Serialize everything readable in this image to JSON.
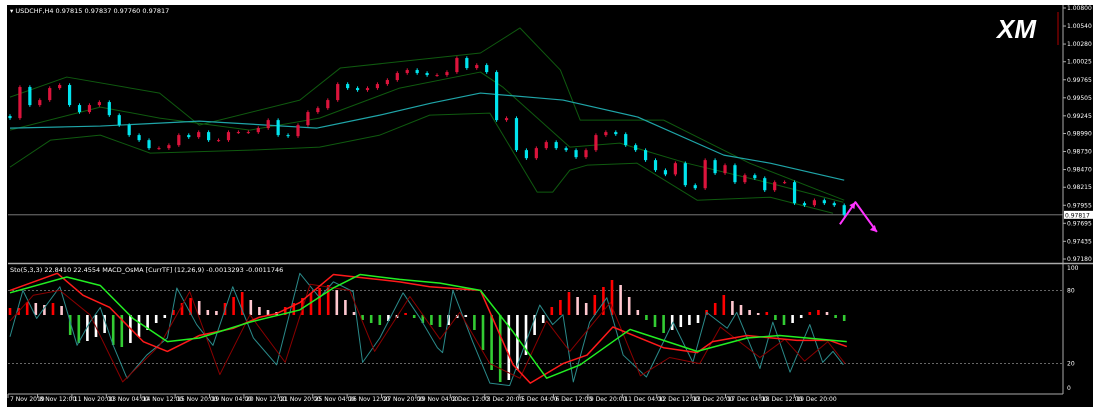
{
  "window": {
    "symbol_header": "USDCHF,H4  0.97815 0.97837 0.97760 0.97817",
    "subwindow_header": "Sto(5,3,3) 22.8410 22.4554  MACD_OsMA [CurrTF] (12,26,9) -0.0013293 -0.0011746",
    "logo_text": "XM",
    "current_price_label": "0.97817"
  },
  "colors": {
    "background": "#000000",
    "bull_candle": "#dc143c",
    "bear_candle": "#00e5ee",
    "moving_average": "#1fa5a8",
    "bollinger": "#0f5a0f",
    "stoch_main": "#2a8a8a",
    "stoch_signal": "#8b0000",
    "osc_red": "#ff1a1a",
    "osc_green": "#22ee22",
    "hist_up_rising": "#ff0000",
    "hist_up_falling": "#ffc8d0",
    "hist_down_falling": "#33cc33",
    "hist_down_rising": "#ffffff",
    "arrow": "#ff33ff"
  },
  "chart_data": [
    {
      "type": "candlestick",
      "symbol": "USDCHF",
      "timeframe": "H4",
      "price_ticks": [
        "1.00800",
        "1.00540",
        "1.00280",
        "1.00025",
        "0.99765",
        "0.99505",
        "0.99245",
        "0.98990",
        "0.98730",
        "0.98470",
        "0.98215",
        "0.97955",
        "0.97695",
        "0.97435",
        "0.97180"
      ],
      "ylim": [
        0.9718,
        1.008
      ],
      "time_labels": [
        "7 Nov 2019",
        "8 Nov 12:00",
        "11 Nov 20:00",
        "13 Nov 04:00",
        "14 Nov 12:00",
        "15 Nov 20:00",
        "19 Nov 04:00",
        "20 Nov 12:00",
        "21 Nov 20:00",
        "25 Nov 04:00",
        "26 Nov 12:00",
        "27 Nov 20:00",
        "29 Nov 04:00",
        "2 Dec 12:00",
        "3 Dec 20:00",
        "5 Dec 04:00",
        "6 Dec 12:00",
        "9 Dec 20:00",
        "11 Dec 04:00",
        "12 Dec 12:00",
        "13 Dec 20:00",
        "17 Dec 04:00",
        "18 Dec 12:00",
        "19 Dec 20:00"
      ],
      "xlim": [
        0,
        97
      ],
      "closes": [
        0.99212,
        0.9966,
        0.994,
        0.99472,
        0.99645,
        0.99689,
        0.994,
        0.99299,
        0.994,
        0.99443,
        0.99255,
        0.99111,
        0.98967,
        0.98894,
        0.98779,
        0.98779,
        0.98822,
        0.98967,
        0.98938,
        0.9901,
        0.98894,
        0.98894,
        0.9901,
        0.9901,
        0.9901,
        0.99068,
        0.99183,
        0.98967,
        0.98952,
        0.99111,
        0.99299,
        0.99356,
        0.99472,
        0.99703,
        0.99645,
        0.99616,
        0.99645,
        0.99703,
        0.99761,
        0.99862,
        0.99905,
        0.99862,
        0.99833,
        0.99833,
        0.99876,
        1.00078,
        0.99934,
        0.99977,
        0.99876,
        0.99183,
        0.99212,
        0.9875,
        0.98634,
        0.98779,
        0.98866,
        0.98779,
        0.9875,
        0.98649,
        0.9875,
        0.98967,
        0.9901,
        0.98981,
        0.98822,
        0.9875,
        0.98606,
        0.98461,
        0.984,
        0.98562,
        0.98245,
        0.98201,
        0.98606,
        0.98418,
        0.98533,
        0.98288,
        0.98389,
        0.98346,
        0.98172,
        0.98288,
        0.98288,
        0.97985,
        0.97956,
        0.98028,
        0.97985,
        0.97956,
        0.97817
      ],
      "moving_average": [
        [
          0,
          0.99068
        ],
        [
          10.5,
          0.99097
        ],
        [
          22,
          0.99169
        ],
        [
          35.7,
          0.99068
        ],
        [
          43,
          0.99255
        ],
        [
          49,
          0.99429
        ],
        [
          54.7,
          0.99573
        ],
        [
          61.6,
          0.99501
        ],
        [
          64.3,
          0.99472
        ],
        [
          73,
          0.99227
        ],
        [
          83,
          0.98678
        ],
        [
          88.4,
          0.98562
        ],
        [
          97,
          0.98317
        ]
      ],
      "bollinger_upper": [
        [
          0,
          0.99515
        ],
        [
          6.6,
          0.99804
        ],
        [
          17.4,
          0.99573
        ],
        [
          22,
          0.99111
        ],
        [
          33.7,
          0.99472
        ],
        [
          38.4,
          0.99934
        ],
        [
          54.7,
          1.00151
        ],
        [
          59.3,
          1.00512
        ],
        [
          64,
          0.99905
        ],
        [
          66.3,
          0.99183
        ],
        [
          76,
          0.99183
        ],
        [
          86,
          0.98562
        ],
        [
          97,
          0.98028
        ]
      ],
      "bollinger_middle": [
        [
          0,
          0.99039
        ],
        [
          10.5,
          0.99371
        ],
        [
          17.4,
          0.99212
        ],
        [
          27.9,
          0.99039
        ],
        [
          36,
          0.99212
        ],
        [
          45.3,
          0.99645
        ],
        [
          54.7,
          0.99876
        ],
        [
          57.3,
          0.9966
        ],
        [
          65.1,
          0.98793
        ],
        [
          70.9,
          0.98851
        ],
        [
          78.7,
          0.98562
        ],
        [
          88.4,
          0.98273
        ],
        [
          96.9,
          0.97999
        ]
      ],
      "bollinger_lower": [
        [
          0,
          0.98505
        ],
        [
          4.7,
          0.98894
        ],
        [
          10.5,
          0.98967
        ],
        [
          16.3,
          0.98707
        ],
        [
          27.9,
          0.9875
        ],
        [
          36,
          0.98793
        ],
        [
          43,
          0.98967
        ],
        [
          48.8,
          0.99255
        ],
        [
          55.8,
          0.99284
        ],
        [
          61.3,
          0.98144
        ],
        [
          63.1,
          0.98144
        ],
        [
          65.1,
          0.98461
        ],
        [
          67.1,
          0.98533
        ],
        [
          72.9,
          0.98562
        ],
        [
          79.9,
          0.98028
        ],
        [
          88.4,
          0.98071
        ],
        [
          95.7,
          0.9784
        ]
      ],
      "current_price": 0.97817,
      "annotation_arrow": [
        [
          96.5,
          0.9768
        ],
        [
          98.3,
          0.98
        ],
        [
          100.8,
          0.9757
        ]
      ]
    },
    {
      "type": "line+bar",
      "ylim": [
        0,
        100
      ],
      "y_ticks": [
        "100",
        "80",
        "20",
        "0"
      ],
      "levels": [
        80,
        20
      ],
      "stoch_main": [
        [
          0,
          42
        ],
        [
          1.5,
          80
        ],
        [
          3.1,
          57
        ],
        [
          5.8,
          83
        ],
        [
          7.8,
          35
        ],
        [
          9.3,
          54
        ],
        [
          10.5,
          66
        ],
        [
          12,
          35
        ],
        [
          13.6,
          8
        ],
        [
          15.9,
          27
        ],
        [
          18.3,
          41
        ],
        [
          19.4,
          82
        ],
        [
          21.7,
          52
        ],
        [
          23.6,
          35
        ],
        [
          25.9,
          83
        ],
        [
          28.3,
          41
        ],
        [
          31,
          19
        ],
        [
          33.7,
          94
        ],
        [
          36,
          74
        ],
        [
          37.6,
          87
        ],
        [
          39.9,
          79
        ],
        [
          41,
          21
        ],
        [
          43,
          41
        ],
        [
          45.7,
          78
        ],
        [
          47.7,
          57
        ],
        [
          49.7,
          33
        ],
        [
          50.3,
          29
        ],
        [
          51.5,
          80
        ],
        [
          53.8,
          38
        ],
        [
          55.8,
          4
        ],
        [
          58.1,
          2
        ],
        [
          61.6,
          68
        ],
        [
          63.1,
          52
        ],
        [
          64.3,
          60
        ],
        [
          65.5,
          5
        ],
        [
          67.4,
          54
        ],
        [
          69.4,
          74
        ],
        [
          71.3,
          27
        ],
        [
          74,
          9
        ],
        [
          77.1,
          54
        ],
        [
          79.4,
          21
        ],
        [
          81,
          62
        ],
        [
          83.4,
          49
        ],
        [
          84.5,
          62
        ],
        [
          87.2,
          16
        ],
        [
          88.7,
          54
        ],
        [
          90.7,
          13
        ],
        [
          93,
          52
        ],
        [
          94.5,
          21
        ],
        [
          95.7,
          30
        ],
        [
          96.9,
          19
        ]
      ],
      "stoch_signal": [
        [
          0,
          55
        ],
        [
          2.7,
          76
        ],
        [
          5.8,
          80
        ],
        [
          9.3,
          60
        ],
        [
          13.1,
          5
        ],
        [
          17.4,
          35
        ],
        [
          20.9,
          79
        ],
        [
          24.4,
          11
        ],
        [
          27.9,
          60
        ],
        [
          32,
          21
        ],
        [
          34.9,
          85
        ],
        [
          39.5,
          80
        ],
        [
          42.4,
          30
        ],
        [
          46.5,
          75
        ],
        [
          50,
          40
        ],
        [
          52.3,
          62
        ],
        [
          55.8,
          20
        ],
        [
          59.3,
          8
        ],
        [
          62.4,
          55
        ],
        [
          65.1,
          30
        ],
        [
          69.8,
          70
        ],
        [
          73.3,
          10
        ],
        [
          76.7,
          25
        ],
        [
          80.2,
          20
        ],
        [
          82.6,
          50
        ],
        [
          87.2,
          25
        ],
        [
          90.1,
          40
        ],
        [
          92.4,
          22
        ],
        [
          95.1,
          38
        ],
        [
          97.1,
          20
        ]
      ],
      "osc_red": [
        [
          0,
          80
        ],
        [
          5.5,
          94
        ],
        [
          8.5,
          76
        ],
        [
          11.6,
          66
        ],
        [
          15.5,
          38
        ],
        [
          18.3,
          30
        ],
        [
          22,
          43
        ],
        [
          26,
          49
        ],
        [
          29,
          58
        ],
        [
          31,
          61
        ],
        [
          33.7,
          70
        ],
        [
          37.6,
          93
        ],
        [
          41.5,
          90
        ],
        [
          45.3,
          87
        ],
        [
          48.8,
          83
        ],
        [
          54.7,
          80
        ],
        [
          58.5,
          19
        ],
        [
          60.5,
          4
        ],
        [
          64.3,
          20
        ],
        [
          67.1,
          27
        ],
        [
          70.1,
          50
        ],
        [
          76,
          33
        ],
        [
          79.9,
          29
        ],
        [
          81.7,
          38
        ],
        [
          85.7,
          43
        ],
        [
          91.5,
          39
        ],
        [
          95.3,
          39
        ],
        [
          97.3,
          34
        ]
      ],
      "osc_green": [
        [
          0,
          78
        ],
        [
          6.6,
          91
        ],
        [
          10.5,
          84
        ],
        [
          14.3,
          57
        ],
        [
          18.3,
          38
        ],
        [
          22,
          41
        ],
        [
          27.9,
          54
        ],
        [
          33.7,
          64
        ],
        [
          37.6,
          82
        ],
        [
          40.7,
          93
        ],
        [
          45.3,
          89
        ],
        [
          50,
          86
        ],
        [
          54.7,
          80
        ],
        [
          58.5,
          46
        ],
        [
          62.4,
          8
        ],
        [
          66.3,
          19
        ],
        [
          72.1,
          48
        ],
        [
          79.9,
          30
        ],
        [
          85.7,
          41
        ],
        [
          89.5,
          43
        ],
        [
          97.3,
          38
        ]
      ],
      "osma_histogram": [
        0.00035,
        0.00035,
        0.00065,
        0.0006,
        0.0005,
        0.0006,
        0.00045,
        -0.001,
        -0.0014,
        -0.0013,
        -0.0011,
        -0.0009,
        -0.0015,
        -0.0016,
        -0.0014,
        -0.0011,
        -0.00075,
        -0.0004,
        -0.00015,
        0.00025,
        0.0006,
        0.00085,
        0.0007,
        0.00025,
        0.0002,
        0.0006,
        0.0009,
        0.00115,
        0.00075,
        0.0004,
        0.00025,
        0.00015,
        0.0004,
        0.0006,
        0.00085,
        0.0011,
        0.00135,
        0.0015,
        0.00125,
        0.00075,
        0.00015,
        -0.00025,
        -0.0004,
        -0.0005,
        -0.0003,
        -0.00015,
        0.0001,
        -0.00015,
        -0.0004,
        -0.0005,
        -0.0006,
        -0.0005,
        -0.00015,
        -0.0001,
        -0.00075,
        -0.00175,
        -0.00275,
        -0.00335,
        -0.00325,
        -0.00275,
        -0.002,
        -0.001,
        -0.0004,
        0.0004,
        0.00075,
        0.00115,
        0.0009,
        0.0006,
        0.001,
        0.0014,
        0.00175,
        0.0015,
        0.0009,
        0.00025,
        -0.00025,
        -0.0006,
        -0.0009,
        -0.00075,
        -0.0006,
        -0.0005,
        -0.0004,
        0.00025,
        0.0006,
        0.001,
        0.0007,
        0.0005,
        0.00025,
        0.0001,
        0.00015,
        -0.00025,
        -0.0005,
        -0.0004,
        -0.00015,
        0.00015,
        0.00025,
        0.00015,
        -0.00015,
        -0.0003
      ]
    }
  ]
}
